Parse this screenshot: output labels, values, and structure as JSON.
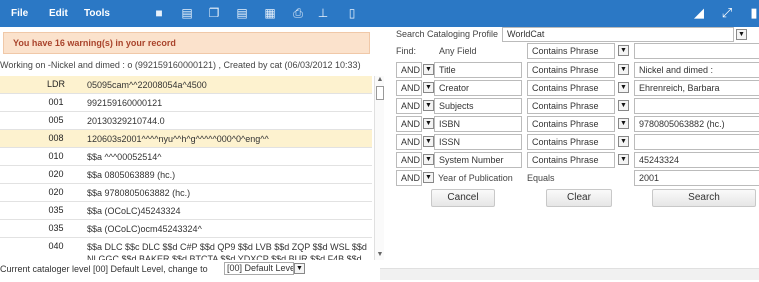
{
  "menu": {
    "file": "File",
    "edit": "Edit",
    "tools": "Tools"
  },
  "toolbar_icons": [
    "save-icon",
    "template-icon",
    "copy-icon",
    "export-icon",
    "record-icon",
    "print-icon",
    "cart-icon",
    "trash-icon"
  ],
  "right_icons": [
    "collapse-icon",
    "fullscreen-icon",
    "panel-icon"
  ],
  "warning": "You have 16 warning(s) in your record",
  "working_on": "Working on -Nickel and dimed : o (992159160000121) , Created by cat (06/03/2012 10:33)",
  "marc_rows": [
    {
      "tag": "LDR",
      "value": "05095cam^^22008054a^4500",
      "highlight": true
    },
    {
      "tag": "001",
      "value": "992159160000121",
      "highlight": false
    },
    {
      "tag": "005",
      "value": "20130329210744.0",
      "highlight": false
    },
    {
      "tag": "008",
      "value": "120603s2001^^^^nyu^^h^g^^^^^000^0^eng^^",
      "highlight": true
    },
    {
      "tag": "010",
      "value": "$$a ^^^00052514^",
      "highlight": false
    },
    {
      "tag": "020",
      "value": "$$a 0805063889 (hc.)",
      "highlight": false
    },
    {
      "tag": "020",
      "value": "$$a 9780805063882 (hc.)",
      "highlight": false
    },
    {
      "tag": "035",
      "value": "$$a (OCoLC)45243324",
      "highlight": false
    },
    {
      "tag": "035",
      "value": "$$a (OCoLC)ocm45243324^",
      "highlight": false
    },
    {
      "tag": "040",
      "value": "$$a DLC $$c DLC $$d C#P $$d QP9 $$d LVB $$d ZQP $$d WSL $$d NLGGC $$d BAKER $$d BTCTA $$d YDXCP $$d BUR $$d F4B $$d GZM $$d UBY",
      "highlight": false
    }
  ],
  "status": {
    "text": "Current cataloger level [00] Default Level, change to",
    "select_value": "[00] Default Leve"
  },
  "search": {
    "profile_label": "Search Cataloging Profile",
    "profile_value": "WorldCat",
    "find_label": "Find:",
    "rows": [
      {
        "bool": "",
        "field": "Any Field",
        "op": "Contains Phrase",
        "value": ""
      },
      {
        "bool": "AND",
        "field": "Title",
        "op": "Contains Phrase",
        "value": "Nickel and dimed :"
      },
      {
        "bool": "AND",
        "field": "Creator",
        "op": "Contains Phrase",
        "value": "Ehrenreich, Barbara"
      },
      {
        "bool": "AND",
        "field": "Subjects",
        "op": "Contains Phrase",
        "value": ""
      },
      {
        "bool": "AND",
        "field": "ISBN",
        "op": "Contains Phrase",
        "value": "9780805063882 (hc.)"
      },
      {
        "bool": "AND",
        "field": "ISSN",
        "op": "Contains Phrase",
        "value": ""
      },
      {
        "bool": "AND",
        "field": "System Number",
        "op": "Contains Phrase",
        "value": "45243324"
      },
      {
        "bool": "AND",
        "field": "Year of Publication",
        "op": "Equals",
        "value": "2001"
      }
    ],
    "cancel": "Cancel",
    "clear": "Clear",
    "search": "Search"
  }
}
